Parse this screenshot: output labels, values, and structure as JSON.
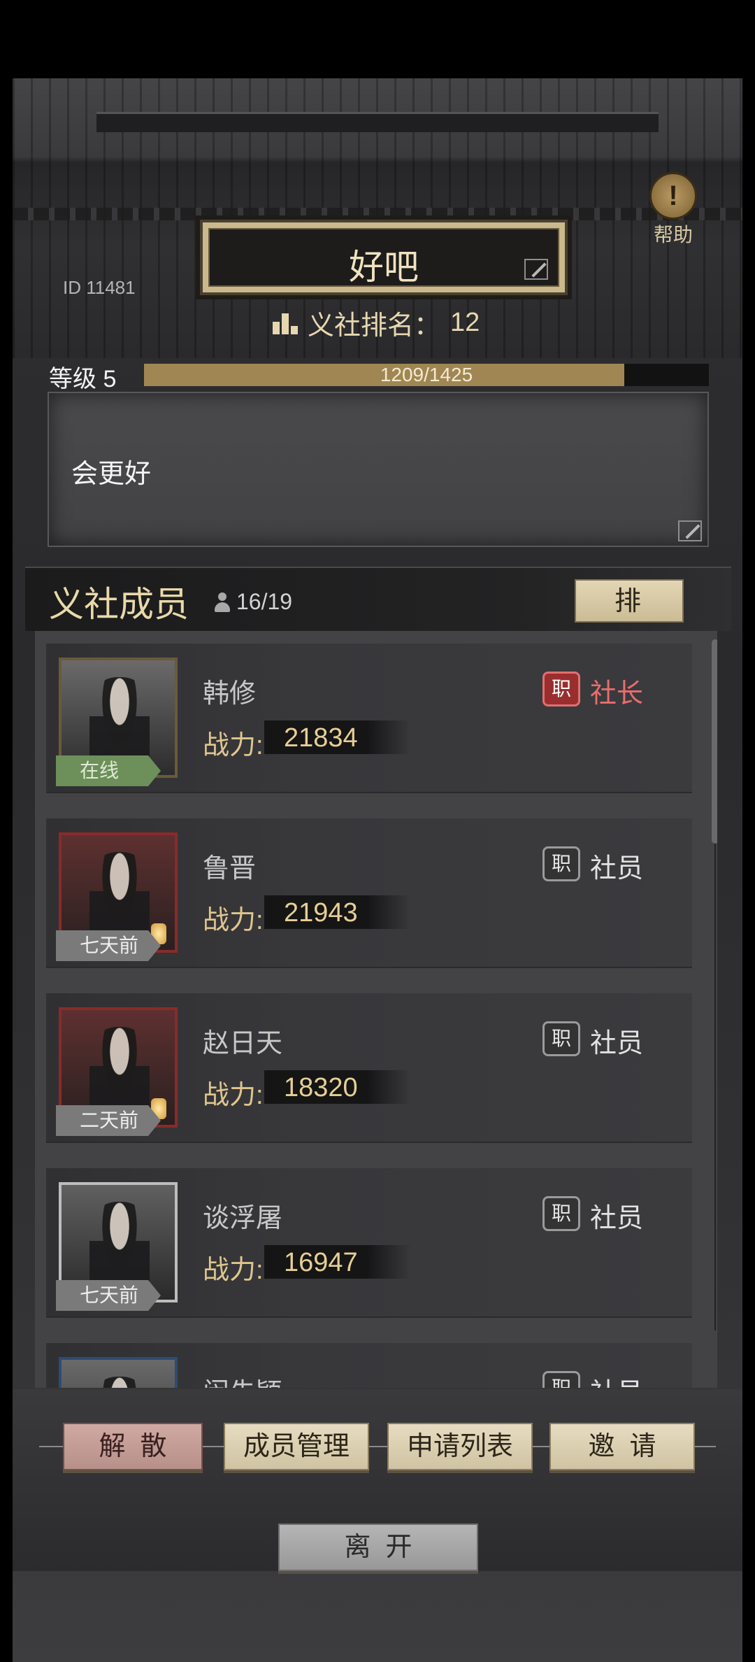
{
  "header": {
    "guild_name": "好吧",
    "id_label": "ID  11481",
    "rank_label": "义社排名：",
    "rank_value": "12",
    "help_label": "帮助",
    "help_icon": "exclamation-icon"
  },
  "level": {
    "label": "等级  5",
    "exp_text": "1209/1425",
    "exp_current": 1209,
    "exp_max": 1425,
    "fill_fraction": 0.85
  },
  "notice": {
    "text": "会更好"
  },
  "members": {
    "title": "义社成员",
    "count": "16/19",
    "sort_label": "排序",
    "power_label": "战力:",
    "role_badge": "职",
    "list": [
      {
        "name": "韩修",
        "power": "21834",
        "role": "社长",
        "status": "在线",
        "online": true
      },
      {
        "name": "鲁晋",
        "power": "21943",
        "role": "社员",
        "status": "七天前",
        "online": false
      },
      {
        "name": "赵日天",
        "power": "18320",
        "role": "社员",
        "status": "二天前",
        "online": false
      },
      {
        "name": "谈浮屠",
        "power": "16947",
        "role": "社员",
        "status": "七天前",
        "online": false
      },
      {
        "name": "闵先颖",
        "power": "",
        "role": "社员",
        "status": "",
        "online": false
      }
    ]
  },
  "actions": {
    "disband": "解  散",
    "manage": "成员管理",
    "applications": "申请列表",
    "invite": "邀  请",
    "leave": "离  开"
  },
  "colors": {
    "accent_gold": "#a08652",
    "leader_red": "#ea6d6d",
    "online_green": "#6d8f5a"
  }
}
